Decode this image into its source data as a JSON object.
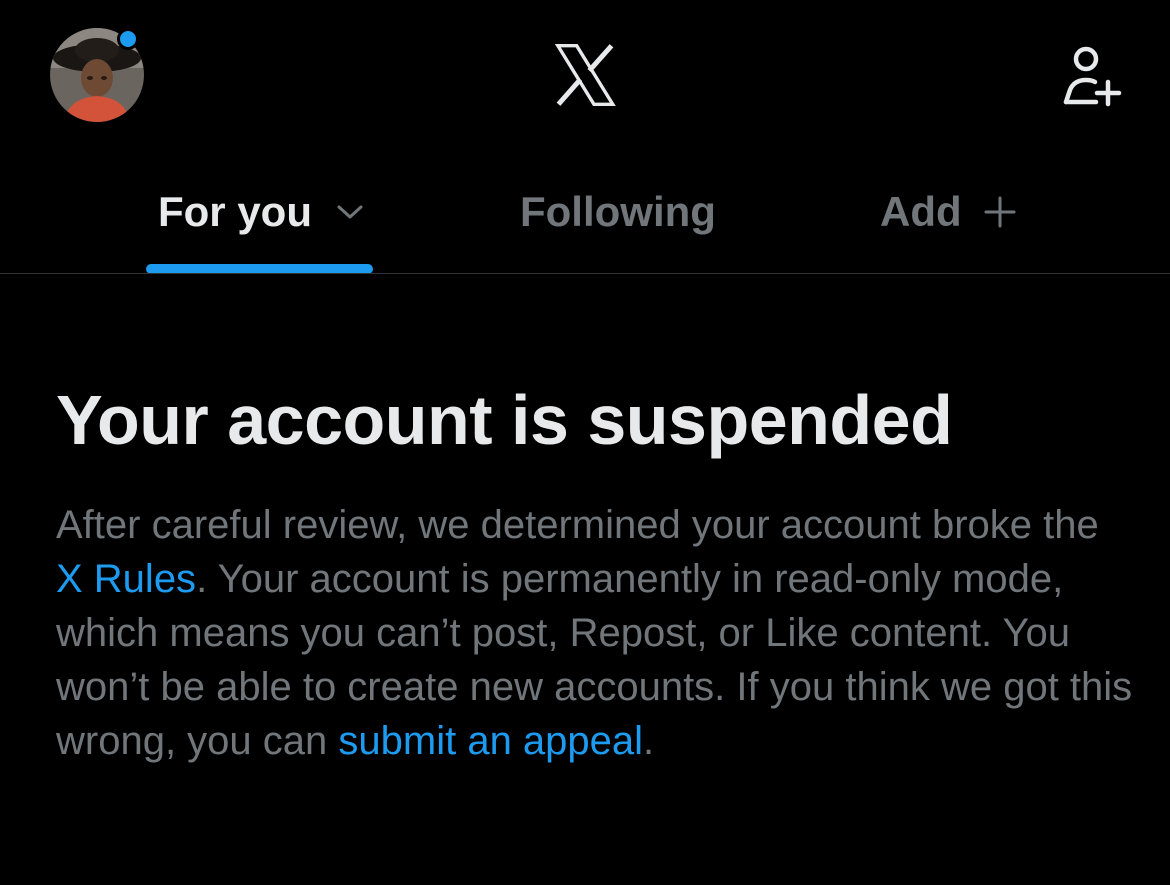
{
  "header": {
    "avatar_alt": "Profile photo",
    "logo_name": "X"
  },
  "tabs": [
    {
      "label": "For you",
      "active": true
    },
    {
      "label": "Following",
      "active": false
    },
    {
      "label": "Add",
      "active": false
    }
  ],
  "notice": {
    "title": "Your account is suspended",
    "body_1": "After careful review, we determined your account broke the ",
    "rules_link": "X Rules",
    "body_2": ". Your account is permanently in read-only mode, which means you can’t post, Repost, or Like content. You won’t be able to create new accounts. If you think we got this wrong, you can ",
    "appeal_link": "submit an appeal",
    "body_3": "."
  },
  "colors": {
    "background": "#000000",
    "accent": "#1d9bf0",
    "primary_text": "#e7e9ea",
    "secondary_text": "#71767b",
    "divider": "#2f3336"
  }
}
